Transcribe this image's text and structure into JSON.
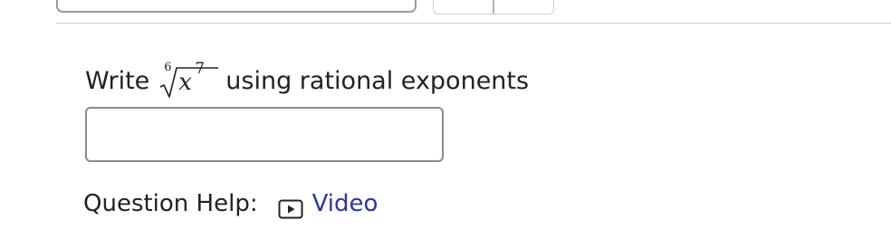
{
  "prompt": {
    "before": "Write",
    "radical_index": "6",
    "radicand_base": "x",
    "radicand_exponent": "7",
    "after": "using rational exponents"
  },
  "answer": {
    "value": "",
    "placeholder": ""
  },
  "help": {
    "label": "Question Help:",
    "video_icon": "play-video-icon",
    "video_link": "Video"
  },
  "colors": {
    "link": "#2b35a8",
    "input_border": "#8a8a8a",
    "divider": "#cfcfcf"
  }
}
